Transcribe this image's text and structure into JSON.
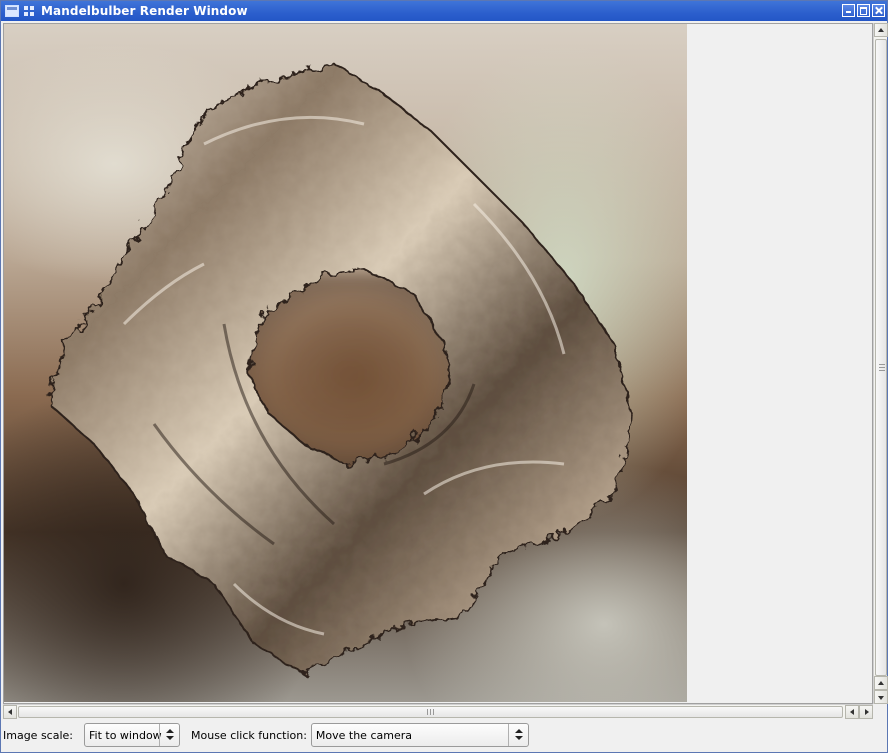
{
  "window": {
    "title": "Mandelbulber Render Window"
  },
  "render": {
    "description_icon": "fractal-render-image"
  },
  "controls": {
    "image_scale_label": "Image scale:",
    "image_scale_value": "Fit to window",
    "mouse_click_label": "Mouse click function:",
    "mouse_click_value": "Move the camera"
  },
  "colors": {
    "titlebar": "#2c5fcd",
    "window_bg": "#f0f0f0"
  }
}
